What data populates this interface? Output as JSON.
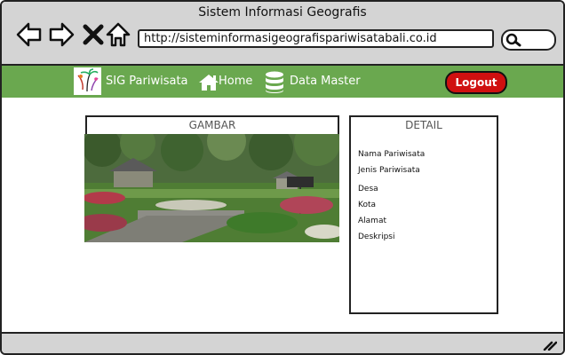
{
  "window": {
    "title": "Sistem Informasi Geografis"
  },
  "browser": {
    "url": "http://sisteminformasigeografispariwisatabali.co.id",
    "icons": [
      "back-arrow-icon",
      "forward-arrow-icon",
      "close-icon",
      "home-icon",
      "search-icon"
    ]
  },
  "navbar": {
    "brand": "SIG Pariwisata",
    "home": "Home",
    "data_master": "Data Master",
    "logout": "Logout",
    "color": "#6aa84f",
    "logout_color": "#d01010"
  },
  "gambar": {
    "title": "GAMBAR"
  },
  "detail": {
    "title": "DETAIL",
    "fields": [
      "Nama Pariwisata",
      "Jenis Pariwisata",
      "Desa",
      "Kota",
      "Alamat",
      "Deskripsi"
    ]
  }
}
